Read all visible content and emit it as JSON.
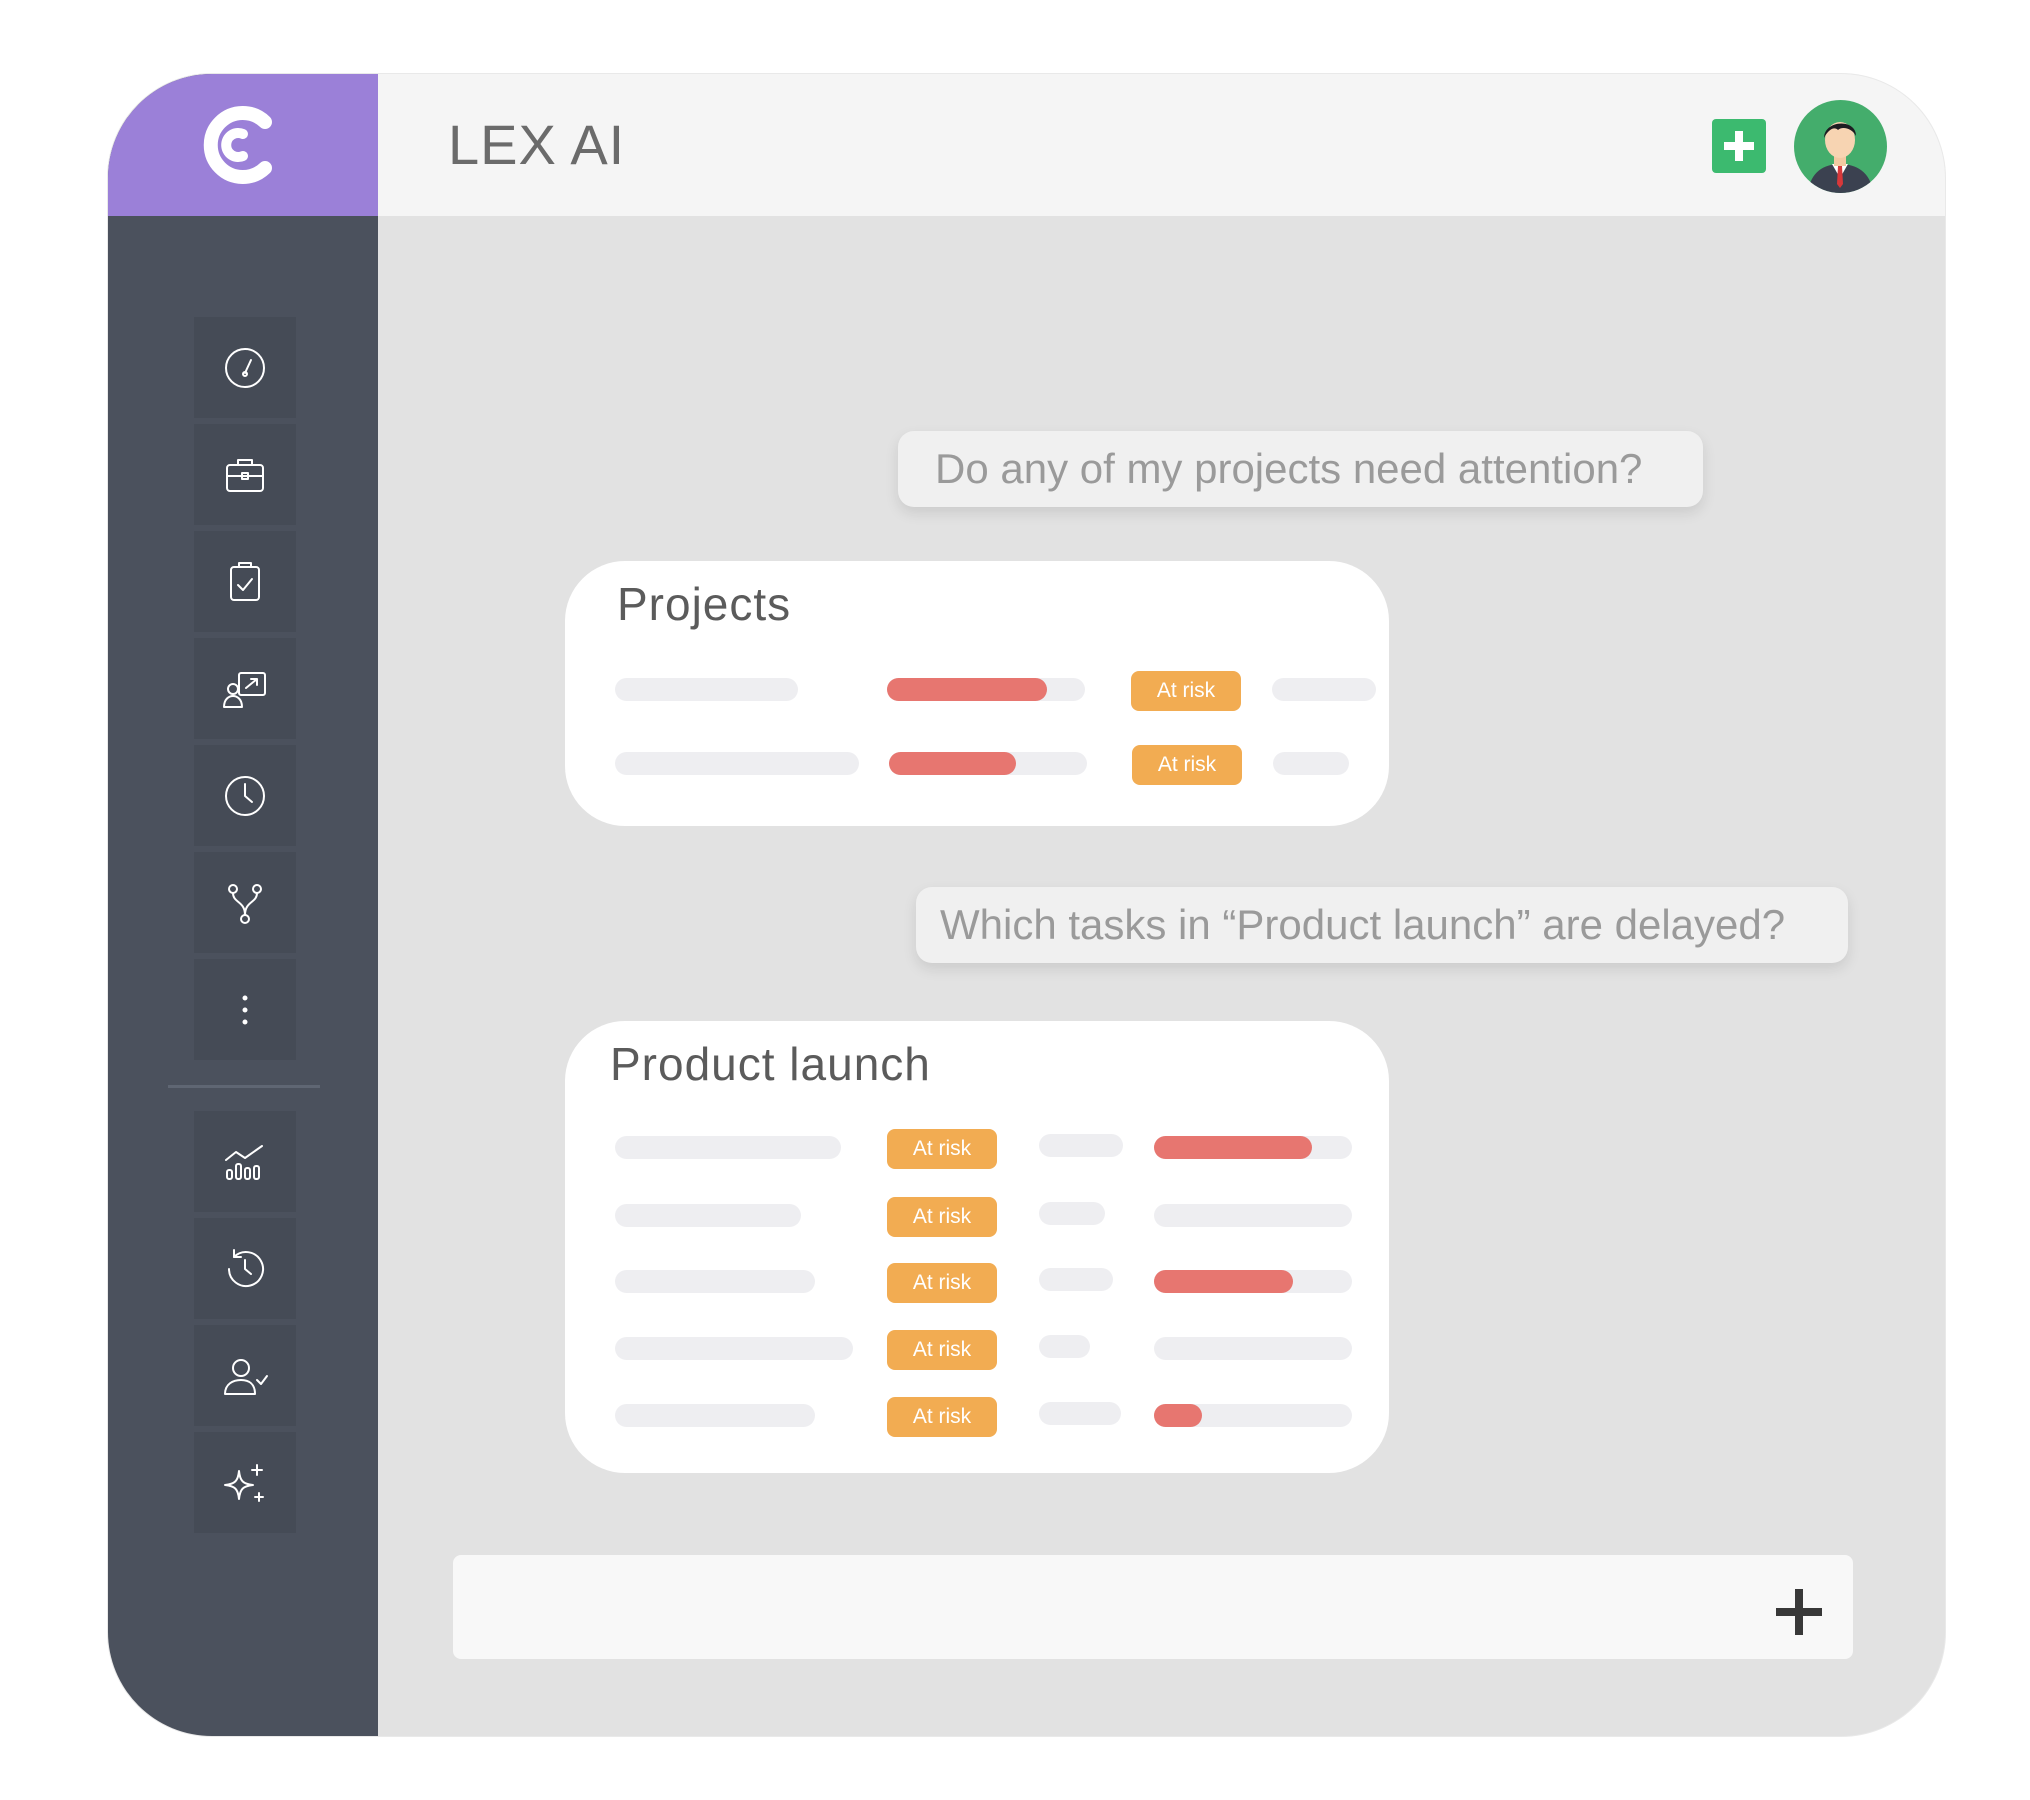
{
  "app": {
    "title": "LEX AI"
  },
  "colors": {
    "accent": "#9b80d8",
    "sidebar": "#4b515d",
    "add": "#3cba6f",
    "risk_badge": "#f2ac52",
    "progress": "#e77670"
  },
  "header": {
    "add_icon": "plus-square-icon",
    "avatar_icon": "user-avatar-icon"
  },
  "sidebar": {
    "items": [
      {
        "icon": "speedometer-icon"
      },
      {
        "icon": "briefcase-icon"
      },
      {
        "icon": "clipboard-check-icon"
      },
      {
        "icon": "presentation-user-icon"
      },
      {
        "icon": "clock-icon"
      },
      {
        "icon": "branch-icon"
      },
      {
        "icon": "more-vertical-icon"
      },
      {
        "icon": "analytics-icon"
      },
      {
        "icon": "history-icon"
      },
      {
        "icon": "user-check-icon"
      },
      {
        "icon": "sparkles-icon"
      }
    ]
  },
  "chat": {
    "q1": "Do any of my projects need attention?",
    "projects": {
      "title": "Projects",
      "rows": [
        {
          "status": "At risk",
          "progress": 0.81
        },
        {
          "status": "At risk",
          "progress": 0.64
        }
      ]
    },
    "q2": "Which tasks in “Product launch” are delayed?",
    "product_launch": {
      "title": "Product launch",
      "rows": [
        {
          "status": "At risk",
          "progress": 0.8
        },
        {
          "status": "At risk",
          "progress": 0.0
        },
        {
          "status": "At risk",
          "progress": 0.7
        },
        {
          "status": "At risk",
          "progress": 0.0
        },
        {
          "status": "At risk",
          "progress": 0.24
        }
      ]
    }
  },
  "composer": {
    "add_icon": "plus-icon"
  }
}
